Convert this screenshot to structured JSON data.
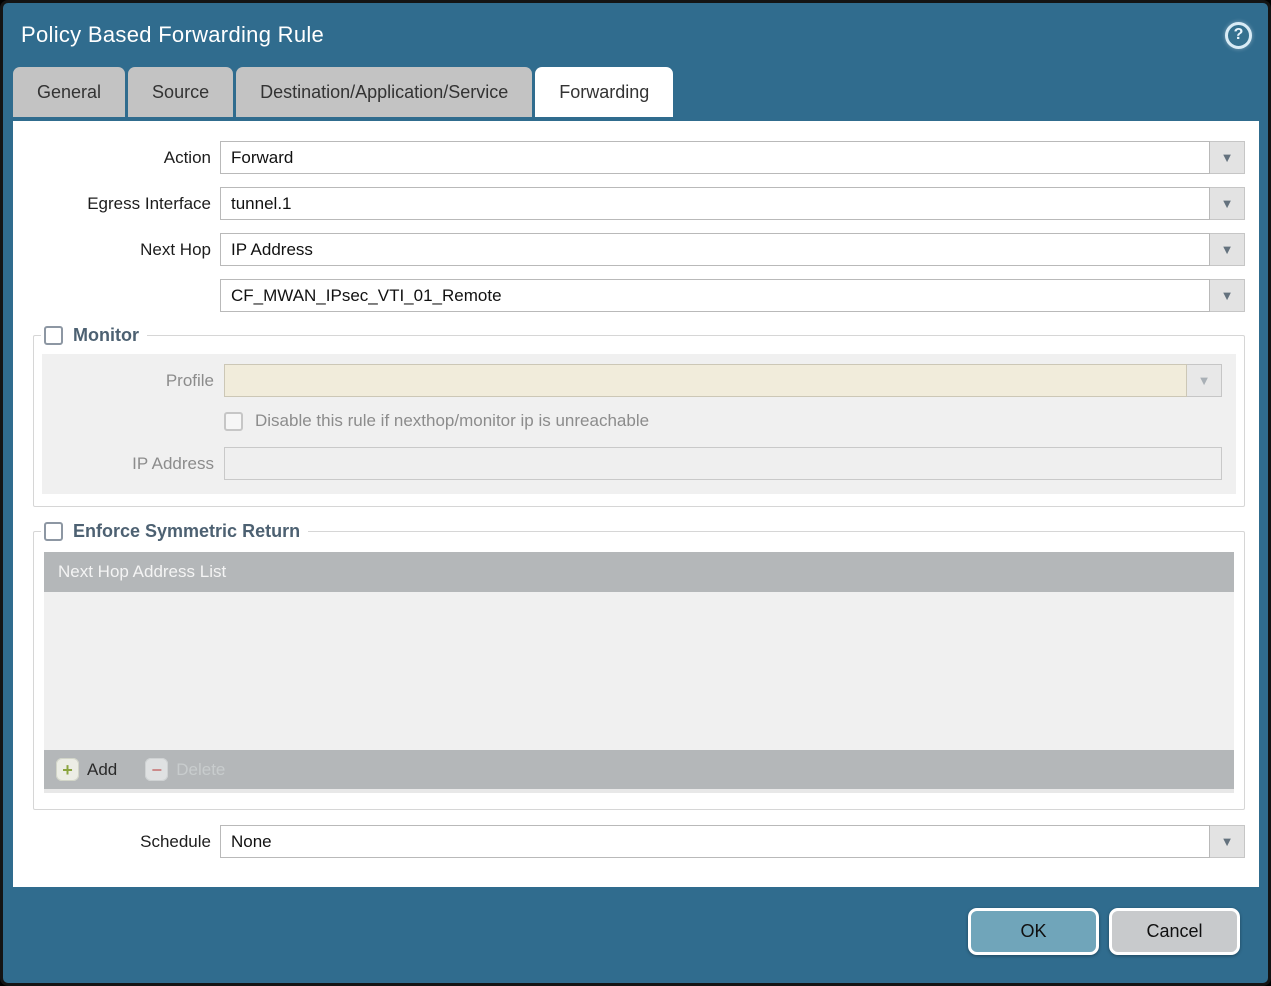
{
  "dialog": {
    "title": "Policy Based Forwarding Rule"
  },
  "icons": {
    "help": "?",
    "dropdown": "▼",
    "add": "+",
    "delete": "−"
  },
  "tabs": [
    {
      "label": "General"
    },
    {
      "label": "Source"
    },
    {
      "label": "Destination/Application/Service"
    },
    {
      "label": "Forwarding"
    }
  ],
  "active_tab": "Forwarding",
  "form": {
    "action_label": "Action",
    "action_value": "Forward",
    "egress_label": "Egress Interface",
    "egress_value": "tunnel.1",
    "next_hop_label": "Next Hop",
    "next_hop_type_value": "IP Address",
    "next_hop_address_value": "CF_MWAN_IPsec_VTI_01_Remote",
    "schedule_label": "Schedule",
    "schedule_value": "None"
  },
  "monitor": {
    "title": "Monitor",
    "checked": false,
    "profile_label": "Profile",
    "profile_value": "",
    "disable_rule_label": "Disable this rule if nexthop/monitor ip is unreachable",
    "disable_rule_checked": false,
    "ip_address_label": "IP Address",
    "ip_address_value": ""
  },
  "enforce_symmetric_return": {
    "title": "Enforce Symmetric Return",
    "checked": false,
    "table_header": "Next Hop Address List",
    "rows": [],
    "add_label": "Add",
    "delete_label": "Delete"
  },
  "footer": {
    "ok_label": "OK",
    "cancel_label": "Cancel"
  },
  "colors": {
    "titlebar_bg": "#306c8e",
    "active_tab_bg": "#ffffff",
    "inactive_tab_bg": "#c3c3c3",
    "section_title": "#4d6172",
    "disabled_field_bg": "#f1ecdb",
    "table_header_bg": "#b4b7b9",
    "ok_button_bg": "#70a5ba",
    "cancel_button_bg": "#c8cacc",
    "add_icon_green": "#8aa43f",
    "delete_icon_red": "#cc8a8a"
  }
}
